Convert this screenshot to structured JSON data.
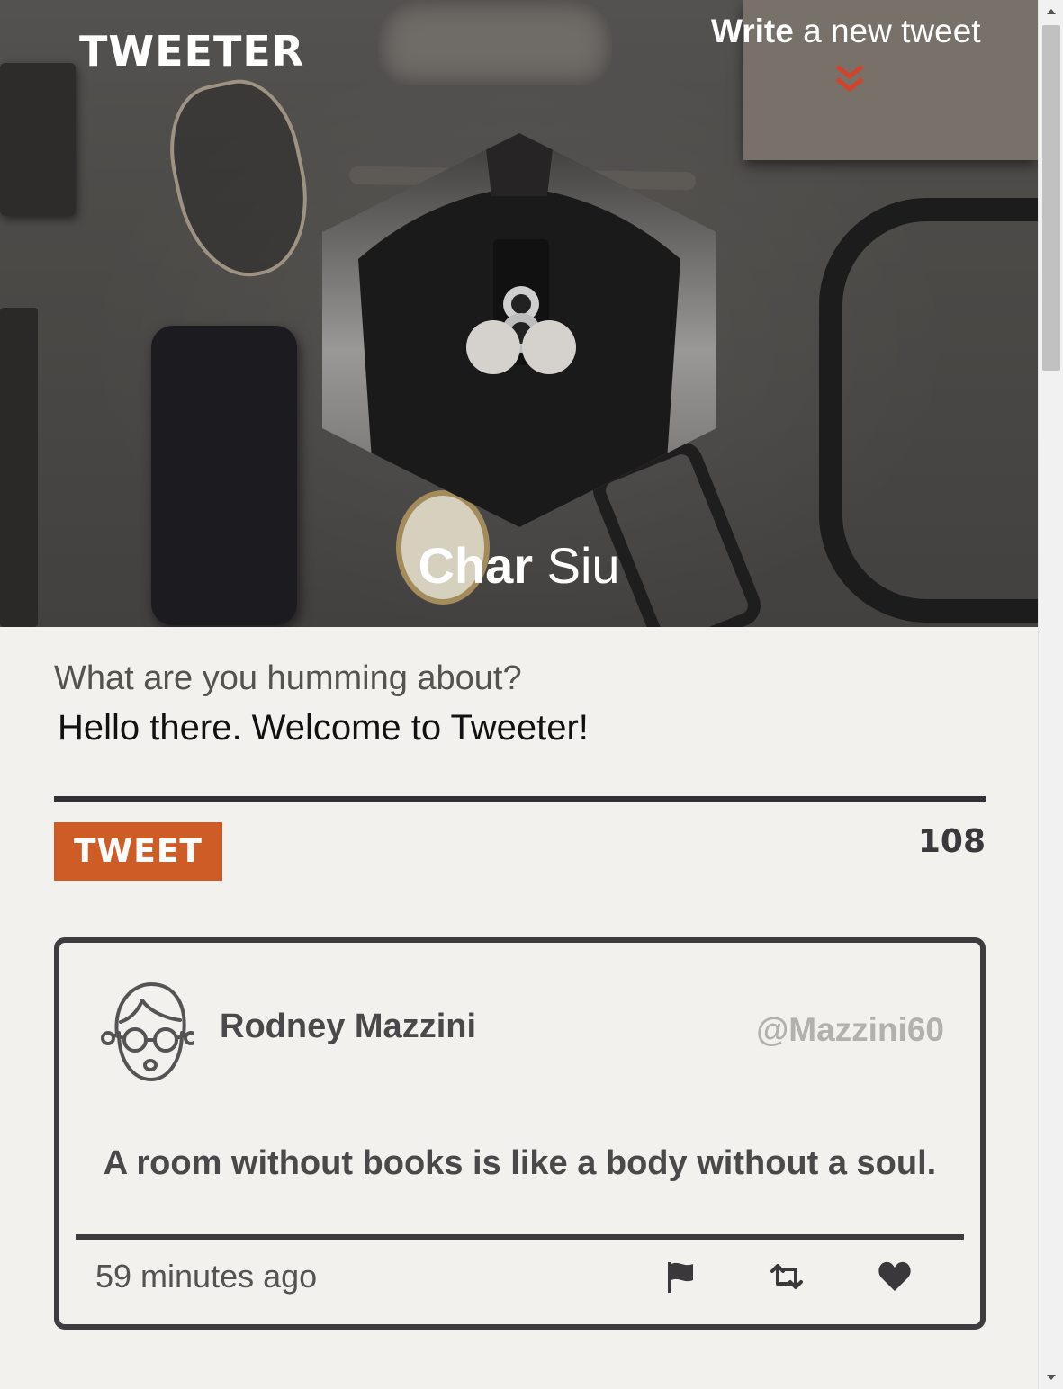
{
  "app": {
    "brand": "TWEETER",
    "write_link": {
      "strong": "Write",
      "light": " a new tweet"
    }
  },
  "profile": {
    "first_name": "Char",
    "last_name": " Siu"
  },
  "compose": {
    "label": "What are you humming about?",
    "value": "Hello there. Welcome to Tweeter!",
    "button_label": "TWEET",
    "char_counter": "108"
  },
  "tweets": [
    {
      "author": "Rodney Mazzini",
      "handle": "@Mazzini60",
      "text": "A room without books is like a body without a soul.",
      "time": "59 minutes ago",
      "actions": [
        "flag-icon",
        "retweet-icon",
        "heart-icon"
      ]
    }
  ],
  "colors": {
    "accent": "#ce5c27",
    "chevron": "#d0442c",
    "border": "#3e3c3e",
    "background": "#f2f1ee"
  }
}
